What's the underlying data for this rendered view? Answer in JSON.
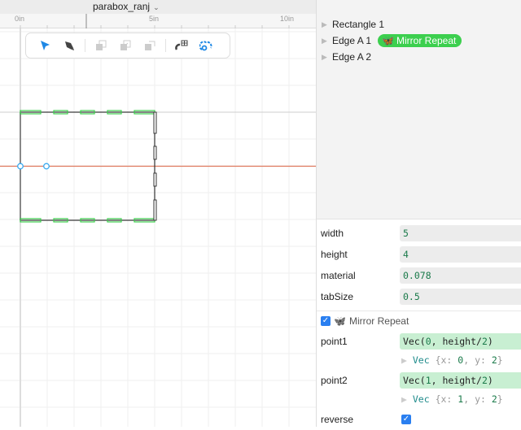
{
  "title": "parabox_ranj",
  "ruler": {
    "labels": [
      "0in",
      "5in",
      "10in"
    ]
  },
  "toolbar": {
    "tools": [
      "select-arrow",
      "pen",
      "send-back",
      "send-front",
      "duplicate",
      "snap-grid",
      "mirror-repeat"
    ]
  },
  "tree": {
    "items": [
      {
        "label": "Rectangle 1"
      },
      {
        "label": "Edge A 1",
        "badge": "Mirror Repeat"
      },
      {
        "label": "Edge A 2"
      }
    ]
  },
  "props": [
    {
      "label": "width",
      "value": "5"
    },
    {
      "label": "height",
      "value": "4"
    },
    {
      "label": "material",
      "value": "0.078"
    },
    {
      "label": "tabSize",
      "value": "0.5"
    }
  ],
  "modifier": {
    "label": "Mirror Repeat",
    "enabled": true,
    "point1": {
      "label": "point1",
      "expr_fn": "Vec(",
      "expr_a": "0",
      "expr_b": ", height/",
      "expr_c": "2",
      "expr_end": ")",
      "res_type": "Vec",
      "res_open": "{x: ",
      "res_x": "0",
      "res_mid": ", y: ",
      "res_y": "2",
      "res_close": "}"
    },
    "point2": {
      "label": "point2",
      "expr_fn": "Vec(",
      "expr_a": "1",
      "expr_b": ", height/",
      "expr_c": "2",
      "expr_end": ")",
      "res_type": "Vec",
      "res_open": "{x: ",
      "res_x": "1",
      "res_mid": ", y: ",
      "res_y": "2",
      "res_close": "}"
    },
    "reverse": {
      "label": "reverse",
      "checked": true
    }
  },
  "colors": {
    "accent": "#2a7ff0",
    "tab": "#3ccf4e",
    "axis": "#e07a5f"
  }
}
